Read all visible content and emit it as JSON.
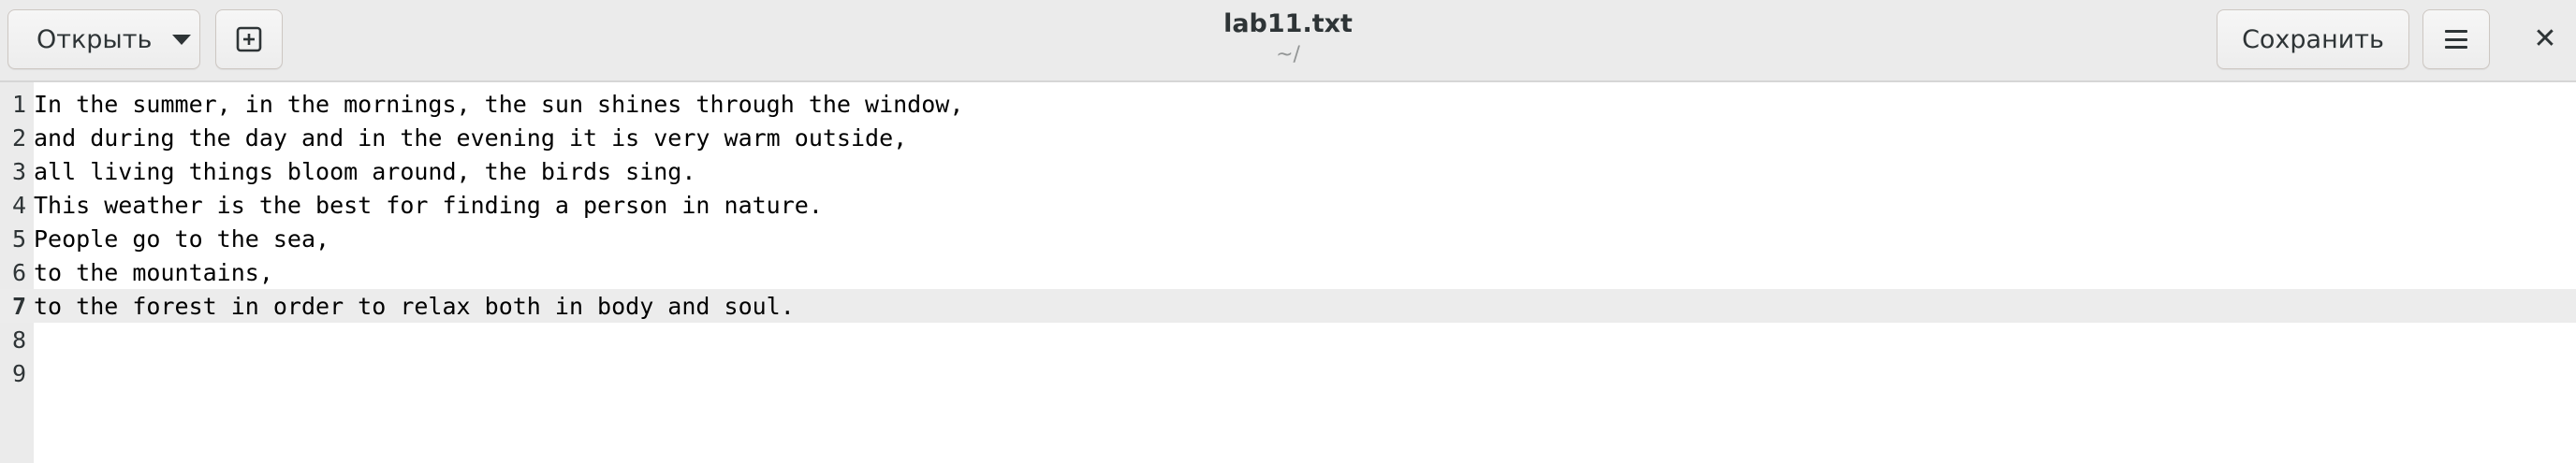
{
  "header": {
    "open_label": "Открыть",
    "save_label": "Сохранить",
    "title": "lab11.txt",
    "subtitle": "~/",
    "close_glyph": "✕"
  },
  "icons": {
    "new_tab": "new-tab-icon",
    "open_dropdown": "chevron-down-icon",
    "menu": "hamburger-menu-icon",
    "close": "close-icon"
  },
  "editor": {
    "current_line": 7,
    "lines": [
      {
        "num": "1",
        "text": "In the summer, in the mornings, the sun shines through the window,"
      },
      {
        "num": "2",
        "text": "and during the day and in the evening it is very warm outside,"
      },
      {
        "num": "3",
        "text": "all living things bloom around, the birds sing."
      },
      {
        "num": "4",
        "text": "This weather is the best for finding a person in nature."
      },
      {
        "num": "5",
        "text": "People go to the sea,"
      },
      {
        "num": "6",
        "text": "to the mountains,"
      },
      {
        "num": "7",
        "text": "to the forest in order to relax both in body and soul."
      },
      {
        "num": "8",
        "text": ""
      },
      {
        "num": "9",
        "text": ""
      }
    ]
  }
}
